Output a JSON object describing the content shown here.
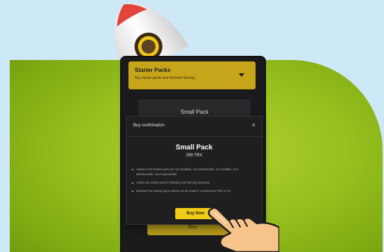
{
  "dropdown": {
    "title": "Starter Packs",
    "subtitle": "Buy starter packs and kickstart farming"
  },
  "pack_card": {
    "title": "Small Pack"
  },
  "modal": {
    "title": "Buy confirmation",
    "close_label": "×",
    "product_name": "Small Pack",
    "price": "299 TRX",
    "notes": [
      "Assets in the starter pack are non-tradable, non-transferable, non-sellable, non-withdrawable, non-buybackable",
      "Assets are solely used to kickstart your farming business",
      "Extracts from starter pack assets can be traded / converted to TRX or GC"
    ],
    "buy_button_label": "Buy Now"
  },
  "background_button": {
    "label": "Buy"
  },
  "colors": {
    "accent_yellow": "#f2cd16",
    "dropdown_gold": "#c7a51b",
    "field_green": "#98c01f",
    "sky_blue": "#cde8f7",
    "panel_dark": "#1b1b1d"
  },
  "icons": {
    "rocket": "rocket-icon",
    "chevron": "chevron-down-icon",
    "close": "close-icon",
    "pointer": "pointing-hand-icon"
  }
}
